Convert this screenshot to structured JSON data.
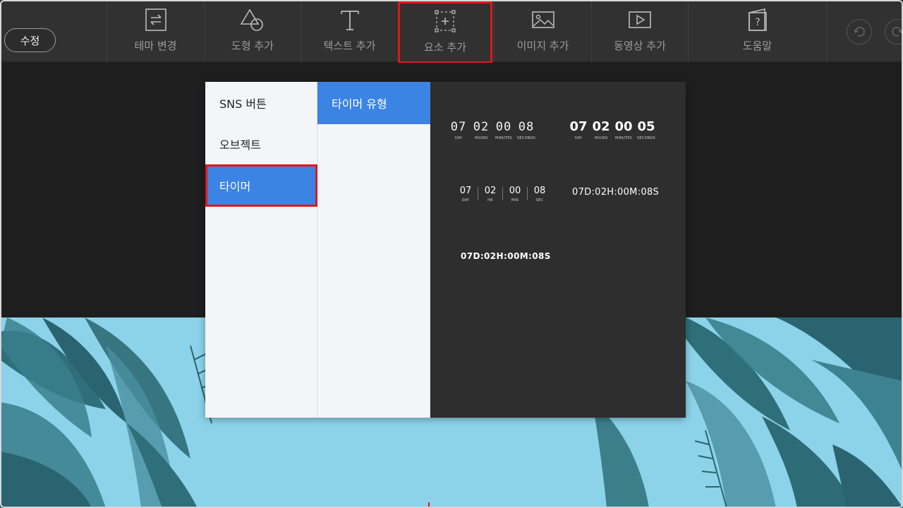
{
  "toolbar": {
    "edit_label": "수정",
    "tools": [
      {
        "label": "테마 변경",
        "icon": "theme-change-icon"
      },
      {
        "label": "도형 추가",
        "icon": "shape-icon"
      },
      {
        "label": "텍스트 추가",
        "icon": "text-icon"
      },
      {
        "label": "요소 추가",
        "icon": "element-add-icon"
      },
      {
        "label": "이미지 추가",
        "icon": "image-icon"
      },
      {
        "label": "동영상 추가",
        "icon": "video-icon"
      },
      {
        "label": "도움말",
        "icon": "help-icon"
      }
    ],
    "undo_icon": "undo-icon",
    "redo_icon": "redo-icon"
  },
  "panel": {
    "categories": [
      "SNS 버튼",
      "오브젝트",
      "타이머"
    ],
    "subcategory": "타이머 유형",
    "timers": {
      "digital": {
        "values": [
          "07",
          "02",
          "00",
          "08"
        ],
        "units": [
          "DAY",
          "HOURS",
          "MINUTES",
          "SECONDS"
        ]
      },
      "bold": {
        "values": [
          "07",
          "02",
          "00",
          "05"
        ],
        "units": [
          "DAY",
          "HOURS",
          "MINUTES",
          "SECONDS"
        ]
      },
      "separated": {
        "values": [
          "07",
          "02",
          "00",
          "08"
        ],
        "units": [
          "DAY",
          "HR",
          "MIN",
          "SEC"
        ]
      },
      "inline_regular": "07D:02H:00M:08S",
      "inline_bold": "07D:02H:00M:08S"
    }
  },
  "colors": {
    "accent": "#3b84e4",
    "highlight": "#e0161b",
    "toolbar_bg": "#313131",
    "stage_sky": "#8cd3ea"
  }
}
